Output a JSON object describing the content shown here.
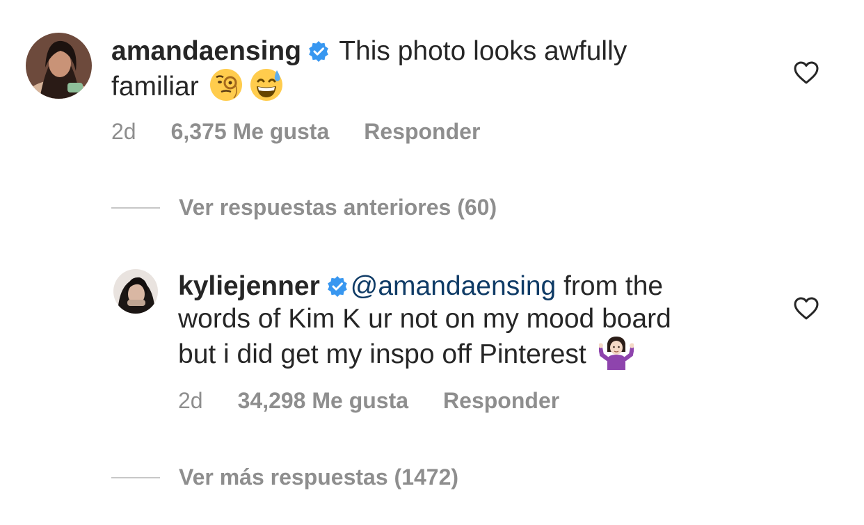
{
  "comments": [
    {
      "username": "amandaensing",
      "verified_icon": "verified-badge-icon",
      "text_line1": " This photo looks awfully",
      "text_line2": "familiar",
      "emojis": [
        "face-with-monocle-emoji",
        "grinning-face-with-sweat-emoji"
      ],
      "timestamp": "2d",
      "likes": "6,375 Me gusta",
      "reply_label": "Responder",
      "like_icon": "heart-icon"
    },
    {
      "username": "kyliejenner",
      "verified_icon": "verified-badge-icon",
      "mention": "@amandaensing",
      "text_line1": " from the",
      "text_line2": "words of Kim K ur not on my mood board",
      "text_line3": "but i did get my inspo off Pinterest",
      "emojis": [
        "person-shrugging-emoji"
      ],
      "timestamp": "2d",
      "likes": "34,298 Me gusta",
      "reply_label": "Responder",
      "like_icon": "heart-icon"
    }
  ],
  "view_previous_replies": "Ver respuestas anteriores (60)",
  "view_more_replies": "Ver más respuestas (1472)",
  "colors": {
    "text": "#262626",
    "secondary": "#8e8e8e",
    "verified": "#3897f0",
    "mention": "#0f3b66"
  }
}
